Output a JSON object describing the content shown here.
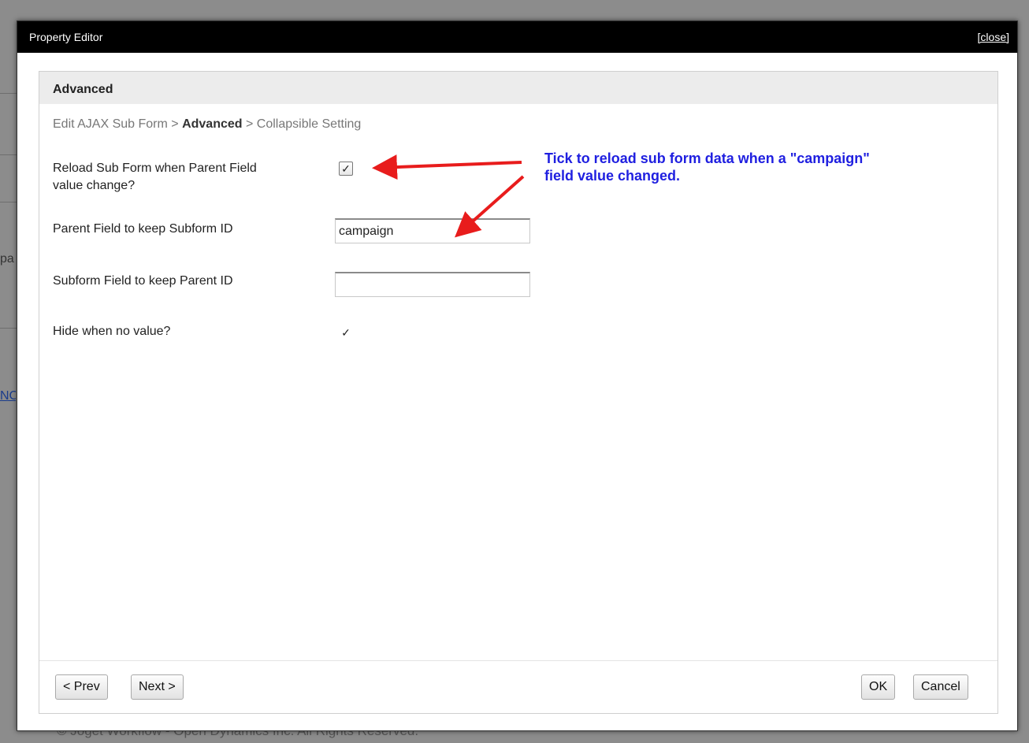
{
  "background": {
    "fragment_1": "pa",
    "fragment_2": "NC",
    "footer": "© Joget Workflow - Open Dynamics Inc. All Rights Reserved."
  },
  "dialog": {
    "title": "Property Editor",
    "close_label": "[close]"
  },
  "panel": {
    "header": "Advanced",
    "breadcrumb": {
      "first": "Edit AJAX Sub Form",
      "sep1": " > ",
      "current": "Advanced",
      "sep2": " > ",
      "last": "Collapsible Setting"
    }
  },
  "fields": {
    "reload_label_line1": "Reload Sub Form when Parent Field",
    "reload_label_line2": "value change?",
    "reload_checked": "✓",
    "parent_field_label": "Parent Field to keep Subform ID",
    "parent_field_value": "campaign",
    "subform_field_label": "Subform Field to keep Parent ID",
    "subform_field_value": "",
    "hide_label": "Hide when no value?",
    "hide_checked": "✓"
  },
  "footer": {
    "prev_label": "< Prev",
    "next_label": "Next >",
    "ok_label": "OK",
    "cancel_label": "Cancel"
  },
  "annotation": {
    "line1": "Tick to reload sub form data when a \"campaign\"",
    "line2": "field value changed.",
    "color": "#1f1fe0",
    "arrow_color": "#e81c1c"
  }
}
